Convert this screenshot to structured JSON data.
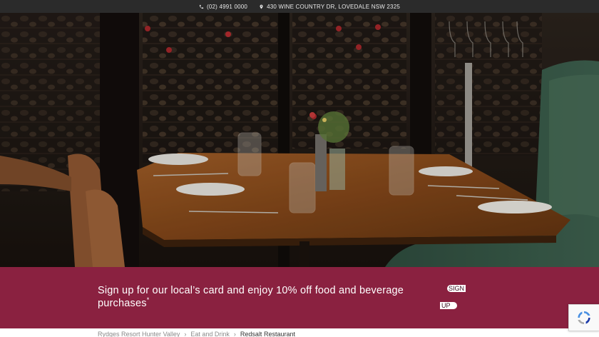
{
  "topbar": {
    "phone": "(02) 4991 0000",
    "address": "430 WINE COUNTRY DR, LOVEDALE NSW 2325",
    "phone_icon": "phone-icon",
    "address_icon": "map-pin-icon"
  },
  "hero": {
    "image": "restaurant-interior-photo"
  },
  "signup": {
    "text": "Sign up for our local’s card and enjoy 10% off food and beverage purchases",
    "asterisk": "*",
    "button_line1": "SIGN",
    "button_line2": "UP",
    "background": "#8a2140"
  },
  "breadcrumb": {
    "items": [
      "Rydges Resort Hunter Valley",
      "Eat and Drink",
      "Redsalt Restaurant"
    ]
  },
  "recaptcha": {
    "icon": "recaptcha-icon"
  }
}
